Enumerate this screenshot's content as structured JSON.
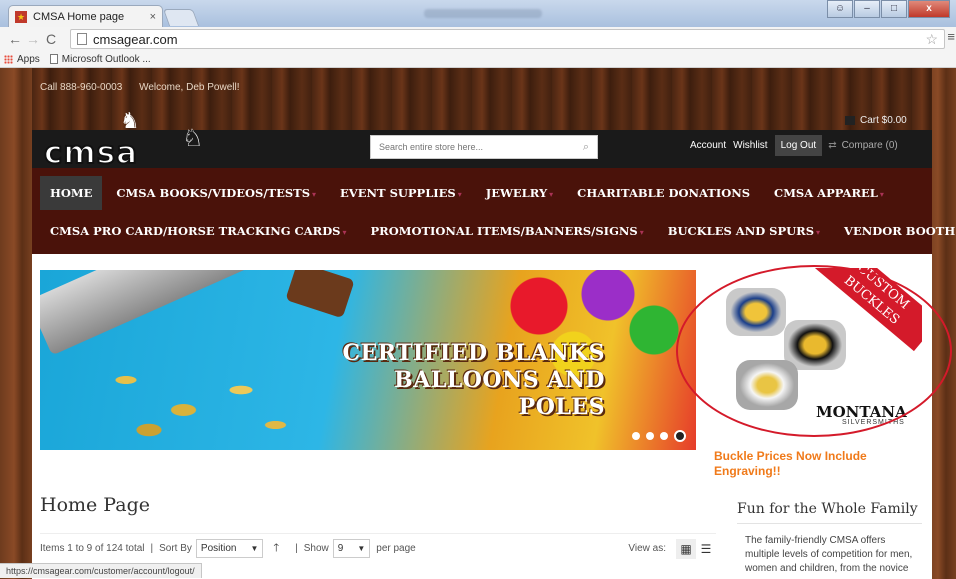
{
  "browser": {
    "tab_title": "CMSA Home page",
    "tab_close": "×",
    "url": "cmsagear.com",
    "bookmarks": [
      "Apps",
      "Microsoft Outlook ..."
    ],
    "status_url": "https://cmsagear.com/customer/account/logout/",
    "icons": [
      "favicon-icon",
      "back-icon",
      "forward-icon",
      "reload-icon",
      "page-icon",
      "star-icon",
      "menu-icon",
      "apps-icon",
      "doc-icon"
    ]
  },
  "top": {
    "phone": "Call 888-960-0003",
    "welcome": "Welcome, Deb Powell!",
    "cart": "Cart $0.00"
  },
  "header": {
    "logo_text": "cmsa",
    "search_placeholder": "Search entire store here...",
    "links": {
      "account": "Account",
      "wishlist": "Wishlist",
      "logout": "Log Out",
      "compare": "Compare (0)"
    }
  },
  "nav": {
    "row1": [
      "HOME",
      "CMSA BOOKS/VIDEOS/TESTS",
      "EVENT SUPPLIES",
      "JEWELRY",
      "CHARITABLE DONATIONS",
      "CMSA APPAREL"
    ],
    "row2": [
      "CMSA PRO CARD/HORSE TRACKING CARDS",
      "PROMOTIONAL ITEMS/BANNERS/SIGNS",
      "BUCKLES AND SPURS",
      "VENDOR BOOTHS"
    ]
  },
  "slider": {
    "line1": "CERTIFIED BLANKS",
    "line2": "BALLOONS AND POLES"
  },
  "buckle_ad": {
    "banner": "CUSTOM BUCKLES",
    "brand": "MONTANA",
    "brand_sub": "SILVERSMITHS",
    "note": "Buckle Prices Now Include Engraving!!"
  },
  "main": {
    "title": "Home Page",
    "items_count": "Items 1 to 9 of 124 total",
    "sort_label": "Sort By",
    "sort_value": "Position",
    "show_label": "Show",
    "show_value": "9",
    "per_page": "per page",
    "view_as": "View as:"
  },
  "sidebar": {
    "title": "Fun for the Whole Family",
    "text": "The family-friendly CMSA offers multiple levels of competition for men, women and children, from the novice"
  },
  "colors": {
    "nav_bg": "#4a120a",
    "header_bg": "#1a1a1a",
    "note_orange": "#f07a1a",
    "ad_red": "#d41a2a"
  }
}
